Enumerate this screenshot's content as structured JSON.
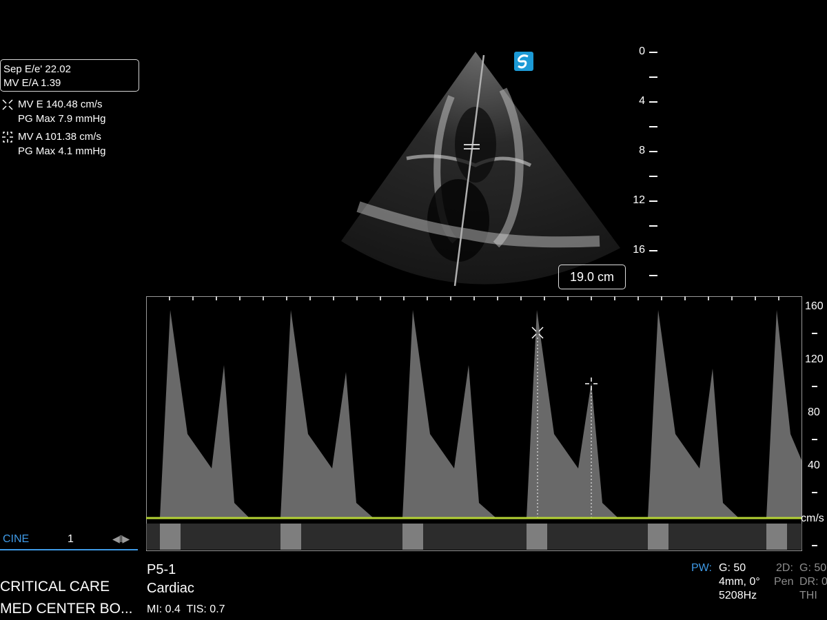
{
  "measurements": {
    "box_lines": [
      "Sep E/e' 22.02",
      "MV E/A 1.39"
    ],
    "mv_e": {
      "label": "MV E 140.48 cm/s",
      "pg": "PG Max 7.9 mmHg",
      "icon": "x-caliper-icon"
    },
    "mv_a": {
      "label": "MV A 101.38 cm/s",
      "pg": "PG Max 4.1 mmHg",
      "icon": "cross-caliper-icon"
    }
  },
  "depth_scale": {
    "labels": [
      "0",
      "4",
      "8",
      "12",
      "16"
    ],
    "depth_readout": "19.0 cm"
  },
  "doppler_scale": {
    "labels": [
      "160",
      "120",
      "80",
      "40"
    ],
    "unit": "cm/s",
    "baseline_color": "#b5d334"
  },
  "cine": {
    "label": "CINE",
    "frame": "1",
    "controls": "◀‖▶"
  },
  "site": {
    "line1": "CRITICAL CARE",
    "line2": "MED CENTER BO..."
  },
  "probe": {
    "name": "P5-1",
    "preset": "Cardiac",
    "mi_tis": "MI: 0.4  TIS: 0.7"
  },
  "pw_settings": {
    "mode": "PW:",
    "gain": "G: 50",
    "gate": "4mm, 0°",
    "prf": "5208Hz"
  },
  "twod_settings": {
    "mode": "2D:",
    "pen": "Pen",
    "gain": "G: 50",
    "dr": "DR: 0",
    "thi": "THI"
  },
  "colors": {
    "accent": "#3f9be8",
    "baseline": "#b5d334",
    "logo": "#1c9ad6"
  }
}
